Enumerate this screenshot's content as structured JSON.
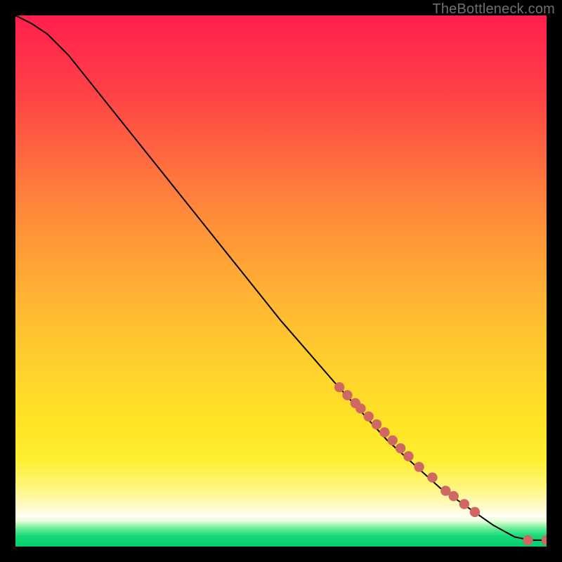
{
  "watermark": "TheBottleneck.com",
  "colors": {
    "curve_stroke": "#000000",
    "marker_fill": "#cf6763",
    "background": "#000000"
  },
  "chart_data": {
    "type": "line",
    "title": "",
    "xlabel": "",
    "ylabel": "",
    "xlim": [
      0,
      100
    ],
    "ylim": [
      0,
      100
    ],
    "grid": false,
    "curve": [
      {
        "x": 0,
        "y": 100
      },
      {
        "x": 3,
        "y": 98.5
      },
      {
        "x": 6,
        "y": 96.5
      },
      {
        "x": 10,
        "y": 92.5
      },
      {
        "x": 20,
        "y": 80
      },
      {
        "x": 30,
        "y": 67.5
      },
      {
        "x": 40,
        "y": 55
      },
      {
        "x": 50,
        "y": 42.5
      },
      {
        "x": 60,
        "y": 31
      },
      {
        "x": 70,
        "y": 20
      },
      {
        "x": 80,
        "y": 11
      },
      {
        "x": 85,
        "y": 7.5
      },
      {
        "x": 90,
        "y": 4
      },
      {
        "x": 94,
        "y": 1.8
      },
      {
        "x": 97,
        "y": 1.2
      },
      {
        "x": 100,
        "y": 1.2
      }
    ],
    "series": [
      {
        "name": "markers",
        "points": [
          {
            "x": 61,
            "y": 30
          },
          {
            "x": 62.5,
            "y": 28.5
          },
          {
            "x": 64,
            "y": 27
          },
          {
            "x": 65,
            "y": 26
          },
          {
            "x": 66.5,
            "y": 24.5
          },
          {
            "x": 68,
            "y": 23
          },
          {
            "x": 69.5,
            "y": 21.5
          },
          {
            "x": 71,
            "y": 20
          },
          {
            "x": 72.5,
            "y": 18.5
          },
          {
            "x": 74,
            "y": 17
          },
          {
            "x": 76,
            "y": 15
          },
          {
            "x": 78.5,
            "y": 13
          },
          {
            "x": 81,
            "y": 10.5
          },
          {
            "x": 82.5,
            "y": 9.5
          },
          {
            "x": 84.5,
            "y": 8
          },
          {
            "x": 86.5,
            "y": 6.5
          },
          {
            "x": 96.5,
            "y": 1.2
          },
          {
            "x": 100,
            "y": 1.2
          }
        ]
      }
    ]
  }
}
